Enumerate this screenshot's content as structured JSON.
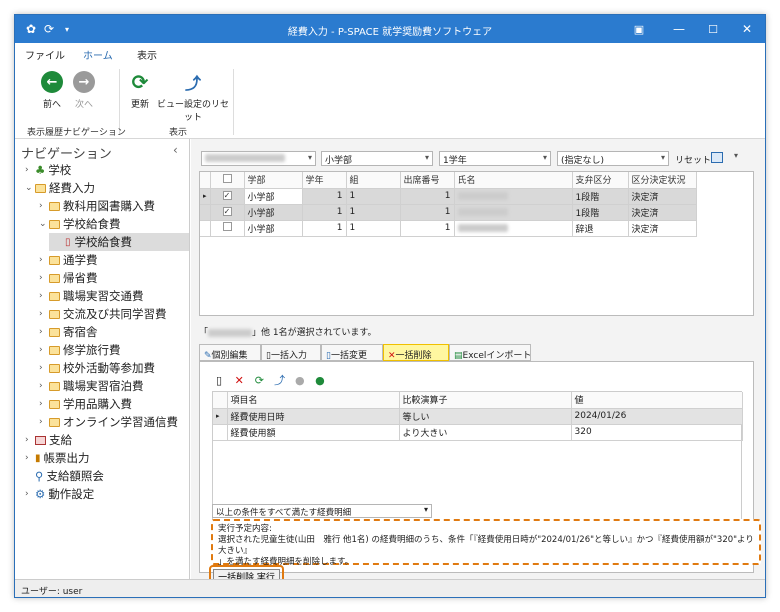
{
  "window": {
    "title": "経費入力 - P-SPACE 就学奨励費ソフトウェア"
  },
  "ribbon": {
    "tabs": [
      "ファイル",
      "ホーム",
      "表示"
    ],
    "buttons": {
      "back": "前へ",
      "next": "次へ",
      "refresh": "更新",
      "reset_view": "ビュー設定のリセット"
    },
    "groups": {
      "history": "表示履歴ナビゲーション",
      "display": "表示"
    }
  },
  "nav": {
    "title": "ナビゲーション",
    "items": [
      {
        "label": "学校",
        "level": 0
      },
      {
        "label": "経費入力",
        "level": 0
      },
      {
        "label": "教科用図書購入費",
        "level": 1
      },
      {
        "label": "学校給食費",
        "level": 1
      },
      {
        "label": "学校給食費",
        "level": 2
      },
      {
        "label": "通学費",
        "level": 1
      },
      {
        "label": "帰省費",
        "level": 1
      },
      {
        "label": "職場実習交通費",
        "level": 1
      },
      {
        "label": "交流及び共同学習費",
        "level": 1
      },
      {
        "label": "寄宿舎",
        "level": 1
      },
      {
        "label": "修学旅行費",
        "level": 1
      },
      {
        "label": "校外活動等参加費",
        "level": 1
      },
      {
        "label": "職場実習宿泊費",
        "level": 1
      },
      {
        "label": "学用品購入費",
        "level": 1
      },
      {
        "label": "オンライン学習通信費",
        "level": 1
      },
      {
        "label": "支給",
        "level": 0
      },
      {
        "label": "帳票出力",
        "level": 0
      },
      {
        "label": "支給額照会",
        "level": 0
      },
      {
        "label": "動作設定",
        "level": 0
      }
    ]
  },
  "filters": {
    "department": "小学部",
    "grade": "1学年",
    "option": "(指定なし)",
    "reset": "リセット"
  },
  "students_table": {
    "headers": [
      "学部",
      "学年",
      "組",
      "出席番号",
      "氏名",
      "支弁区分",
      "区分決定状況"
    ],
    "rows": [
      {
        "checked": "✓",
        "dept": "小学部",
        "grade": "1",
        "class": "1",
        "no": "1",
        "level": "1段階",
        "status": "決定済"
      },
      {
        "checked": "✓",
        "dept": "小学部",
        "grade": "1",
        "class": "1",
        "no": "1",
        "level": "1段階",
        "status": "決定済"
      },
      {
        "checked": "",
        "dept": "小学部",
        "grade": "1",
        "class": "1",
        "no": "1",
        "level": "辞退",
        "status": "決定済"
      }
    ]
  },
  "selection_info": "他 1名が選択されています。",
  "tabs": [
    "個別編集",
    "一括入力",
    "一括変更",
    "一括削除",
    "Excelインポート"
  ],
  "conditions_table": {
    "headers": [
      "項目名",
      "比較演算子",
      "値"
    ],
    "rows": [
      {
        "item": "経費使用日時",
        "op": "等しい",
        "value": "2024/01/26"
      },
      {
        "item": "経費使用額",
        "op": "より大きい",
        "value": "320"
      }
    ]
  },
  "condition_mode": "以上の条件をすべて満たす経費明細",
  "plan": {
    "title": "実行予定内容:",
    "line1": "選択された児童生徒(山田　雅行 他1名) の経費明細のうち、条件「『経費使用日時が\"2024/01/26\"と等しい』かつ『経費使用額が\"320\"より大きい』",
    "line2": "」を満たす経費明細を削除します。"
  },
  "execute_button": "一括削除 実行",
  "status_bar": "ユーザー: user",
  "colors": {
    "titlebar": "#2b7bcf",
    "highlight": "#fff7a0",
    "outline": "#e07a10"
  }
}
